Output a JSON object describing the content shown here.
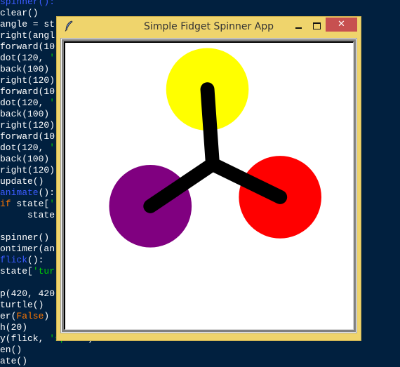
{
  "editor": {
    "lines": [
      [
        {
          "t": "spinner():",
          "c": "fn"
        }
      ],
      [
        {
          "t": "clear()"
        }
      ],
      [
        {
          "t": "angle = st"
        }
      ],
      [
        {
          "t": "right(angl"
        }
      ],
      [
        {
          "t": "forward(10"
        }
      ],
      [
        {
          "t": "dot(120, "
        },
        {
          "t": "'",
          "c": "str"
        }
      ],
      [
        {
          "t": "back(100)"
        }
      ],
      [
        {
          "t": "right(120)"
        }
      ],
      [
        {
          "t": "forward(10"
        }
      ],
      [
        {
          "t": "dot(120, "
        },
        {
          "t": "'",
          "c": "str"
        }
      ],
      [
        {
          "t": "back(100)"
        }
      ],
      [
        {
          "t": "right(120)"
        }
      ],
      [
        {
          "t": "forward(10"
        }
      ],
      [
        {
          "t": "dot(120, "
        },
        {
          "t": "'",
          "c": "str"
        }
      ],
      [
        {
          "t": "back(100)"
        }
      ],
      [
        {
          "t": "right(120)"
        }
      ],
      [
        {
          "t": "update()"
        }
      ],
      [
        {
          "t": "animate",
          "c": "fn"
        },
        {
          "t": "():"
        }
      ],
      [
        {
          "t": "if",
          "c": "kw"
        },
        {
          "t": " state["
        },
        {
          "t": "'",
          "c": "str"
        }
      ],
      [
        {
          "t": "     state["
        }
      ],
      [
        {
          "t": ""
        }
      ],
      [
        {
          "t": "spinner()"
        }
      ],
      [
        {
          "t": "ontimer(an"
        }
      ],
      [
        {
          "t": "flick",
          "c": "fn"
        },
        {
          "t": "():"
        }
      ],
      [
        {
          "t": "state["
        },
        {
          "t": "'tur",
          "c": "str"
        }
      ],
      [
        {
          "t": ""
        }
      ],
      [
        {
          "t": "p(420, 420"
        }
      ],
      [
        {
          "t": "turtle()"
        }
      ],
      [
        {
          "t": "er("
        },
        {
          "t": "False",
          "c": "kw"
        },
        {
          "t": ")"
        }
      ],
      [
        {
          "t": "h(20)"
        }
      ],
      [
        {
          "t": "y(flick, "
        },
        {
          "t": "'space'",
          "c": "str"
        },
        {
          "t": ")"
        }
      ],
      [
        {
          "t": "en()"
        }
      ],
      [
        {
          "t": "ate()"
        }
      ]
    ]
  },
  "window": {
    "title": "Simple Fidget Spinner App",
    "app_icon": "feather-icon",
    "buttons": {
      "minimize": "–",
      "maximize": "☐",
      "close": "✕"
    }
  },
  "spinner": {
    "heading_deg": 94,
    "arm_length": 100,
    "dot_size": 120,
    "colors": {
      "arm": "#000000",
      "dots": [
        "#ffff00",
        "#ff0000",
        "#800080"
      ]
    }
  }
}
